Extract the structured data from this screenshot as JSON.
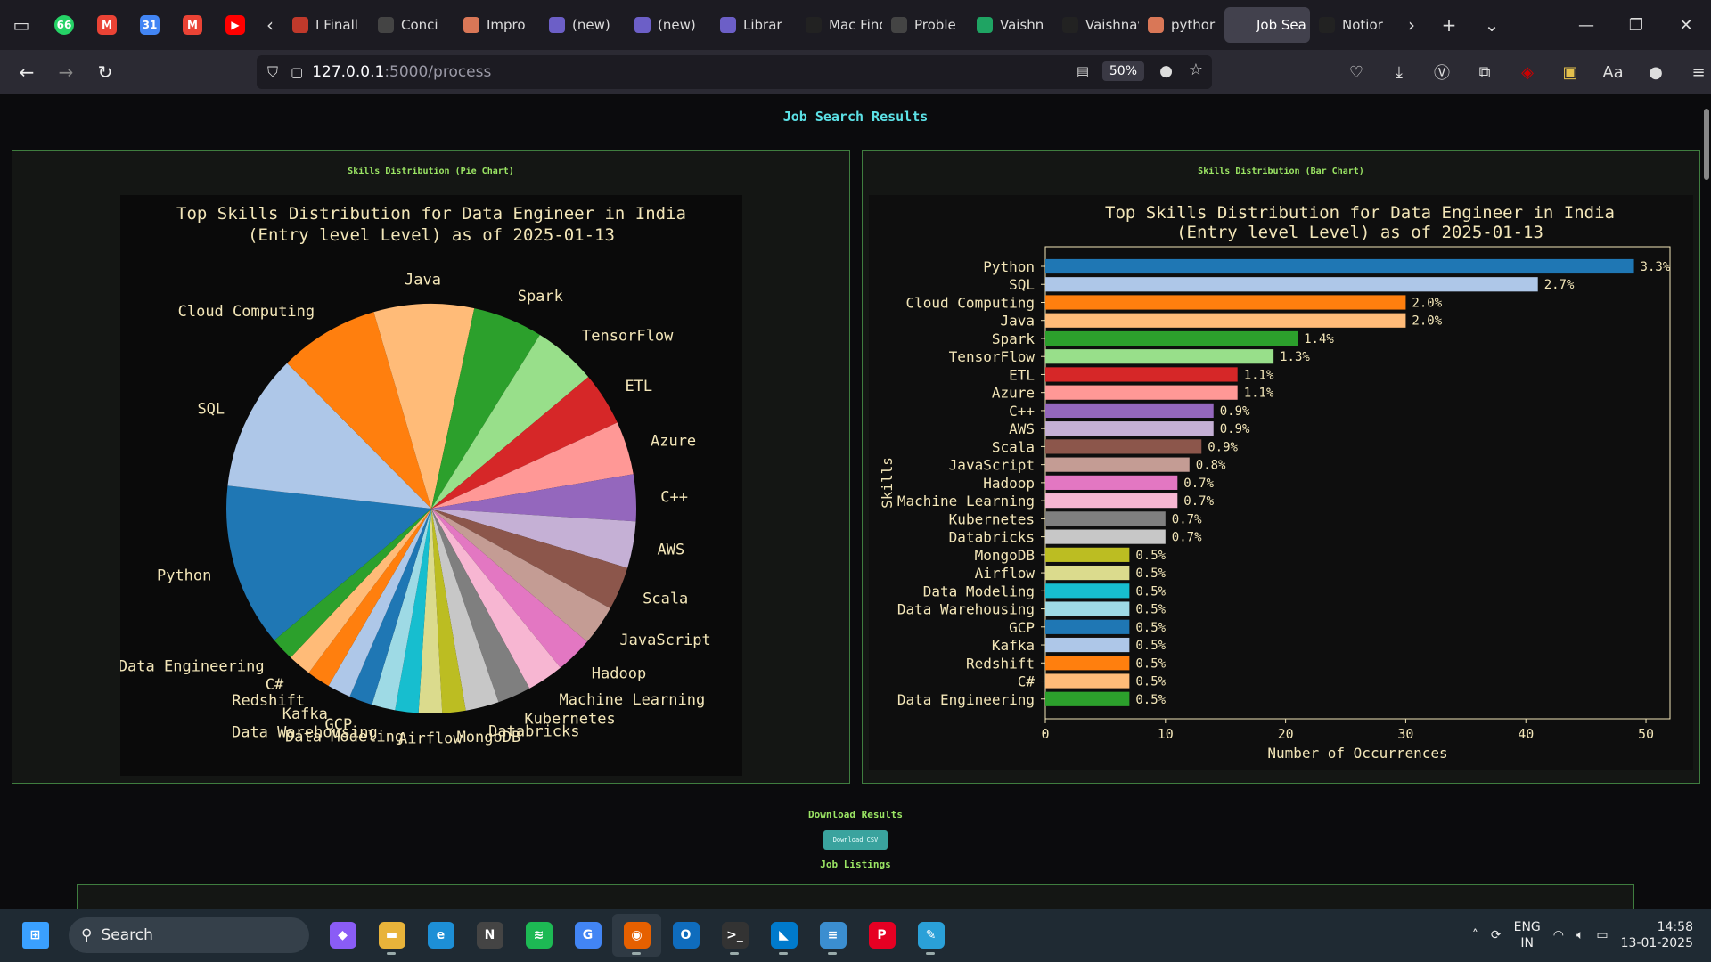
{
  "browser": {
    "tabs": [
      {
        "label": "I Finall",
        "fav": "#c0392b",
        "icon": "pin-icon"
      },
      {
        "label": "Conci",
        "fav": "#444",
        "icon": "openai-icon"
      },
      {
        "label": "Impro",
        "fav": "#d97757",
        "icon": "claude-icon"
      },
      {
        "label": "(new)",
        "fav": "#6c5fc7",
        "icon": "obsidian-icon"
      },
      {
        "label": "(new)",
        "fav": "#6c5fc7",
        "icon": "obsidian-icon"
      },
      {
        "label": "Librar",
        "fav": "#6c5fc7",
        "icon": "obsidian-icon"
      },
      {
        "label": "Mac Finde",
        "fav": "#222",
        "icon": "apple-icon"
      },
      {
        "label": "Proble",
        "fav": "#444",
        "icon": "info-icon"
      },
      {
        "label": "Vaishn",
        "fav": "#1fa463",
        "icon": "drive-icon"
      },
      {
        "label": "Vaishnavi",
        "fav": "#222",
        "icon": "page-icon"
      },
      {
        "label": "pythor",
        "fav": "#d97757",
        "icon": "claude-icon"
      },
      {
        "label": "Job Sea",
        "fav": "#42414d",
        "icon": "page-icon"
      },
      {
        "label": "Notior",
        "fav": "#222",
        "icon": "notion-icon"
      }
    ],
    "url_host": "127.0.0.1",
    "url_path": ":5000/process",
    "zoom": "50%"
  },
  "page": {
    "title": "Job Search Results",
    "pie_panel_title": "Skills Distribution (Pie Chart)",
    "bar_panel_title": "Skills Distribution (Bar Chart)",
    "download_title": "Download Results",
    "download_button": "Download CSV",
    "listings_title": "Job Listings"
  },
  "chart_data": [
    {
      "type": "pie",
      "title": "Top Skills Distribution for Data Engineer in India (Entry level Level) as of 2025-01-13",
      "categories": [
        "Python",
        "SQL",
        "Cloud Computing",
        "Java",
        "Spark",
        "TensorFlow",
        "ETL",
        "Azure",
        "C++",
        "AWS",
        "Scala",
        "JavaScript",
        "Hadoop",
        "Machine Learning",
        "Kubernetes",
        "Databricks",
        "MongoDB",
        "Airflow",
        "Data Modeling",
        "Data Warehousing",
        "GCP",
        "Kafka",
        "Redshift",
        "C#",
        "Data Engineering"
      ],
      "values": [
        49,
        41,
        30,
        30,
        21,
        19,
        16,
        16,
        14,
        14,
        13,
        12,
        11,
        11,
        10,
        10,
        7,
        7,
        7,
        7,
        7,
        7,
        7,
        7,
        7
      ],
      "colors": [
        "#1f77b4",
        "#aec7e8",
        "#ff7f0e",
        "#ffbb78",
        "#2ca02c",
        "#98df8a",
        "#d62728",
        "#ff9896",
        "#9467bd",
        "#c5b0d5",
        "#8c564b",
        "#c49c94",
        "#e377c2",
        "#f7b6d2",
        "#7f7f7f",
        "#c7c7c7",
        "#bcbd22",
        "#dbdb8d",
        "#17becf",
        "#9edae5",
        "#1f77b4",
        "#aec7e8",
        "#ff7f0e",
        "#ffbb78",
        "#2ca02c"
      ]
    },
    {
      "type": "bar",
      "title": "Top Skills Distribution for Data Engineer in India (Entry level Level) as of 2025-01-13",
      "xlabel": "Number of Occurrences",
      "ylabel": "Skills",
      "xlim": [
        0,
        52
      ],
      "xticks": [
        0,
        10,
        20,
        30,
        40,
        50
      ],
      "categories": [
        "Python",
        "SQL",
        "Cloud Computing",
        "Java",
        "Spark",
        "TensorFlow",
        "ETL",
        "Azure",
        "C++",
        "AWS",
        "Scala",
        "JavaScript",
        "Hadoop",
        "Machine Learning",
        "Kubernetes",
        "Databricks",
        "MongoDB",
        "Airflow",
        "Data Modeling",
        "Data Warehousing",
        "GCP",
        "Kafka",
        "Redshift",
        "C#",
        "Data Engineering"
      ],
      "values": [
        49,
        41,
        30,
        30,
        21,
        19,
        16,
        16,
        14,
        14,
        13,
        12,
        11,
        11,
        10,
        10,
        7,
        7,
        7,
        7,
        7,
        7,
        7,
        7,
        7
      ],
      "labels": [
        "3.3%",
        "2.7%",
        "2.0%",
        "2.0%",
        "1.4%",
        "1.3%",
        "1.1%",
        "1.1%",
        "0.9%",
        "0.9%",
        "0.9%",
        "0.8%",
        "0.7%",
        "0.7%",
        "0.7%",
        "0.7%",
        "0.5%",
        "0.5%",
        "0.5%",
        "0.5%",
        "0.5%",
        "0.5%",
        "0.5%",
        "0.5%",
        "0.5%"
      ],
      "colors": [
        "#1f77b4",
        "#aec7e8",
        "#ff7f0e",
        "#ffbb78",
        "#2ca02c",
        "#98df8a",
        "#d62728",
        "#ff9896",
        "#9467bd",
        "#c5b0d5",
        "#8c564b",
        "#c49c94",
        "#e377c2",
        "#f7b6d2",
        "#7f7f7f",
        "#c7c7c7",
        "#bcbd22",
        "#dbdb8d",
        "#17becf",
        "#9edae5",
        "#1f77b4",
        "#aec7e8",
        "#ff7f0e",
        "#ffbb78",
        "#2ca02c"
      ]
    }
  ],
  "taskbar": {
    "search_label": "Search",
    "apps": [
      {
        "name": "copilot-icon",
        "color": "#8a5cf6",
        "glyph": "◆"
      },
      {
        "name": "file-explorer-icon",
        "color": "#e8b33a",
        "glyph": "▬"
      },
      {
        "name": "edge-icon",
        "color": "#1d8fd6",
        "glyph": "e"
      },
      {
        "name": "notion-icon",
        "color": "#444",
        "glyph": "N"
      },
      {
        "name": "spotify-icon",
        "color": "#1db954",
        "glyph": "≋"
      },
      {
        "name": "chrome-icon",
        "color": "#4285f4",
        "glyph": "G"
      },
      {
        "name": "firefox-icon",
        "color": "#e66000",
        "glyph": "◉"
      },
      {
        "name": "outlook-icon",
        "color": "#0f6cbd",
        "glyph": "O"
      },
      {
        "name": "terminal-icon",
        "color": "#333",
        "glyph": ">_"
      },
      {
        "name": "vscode-icon",
        "color": "#007acc",
        "glyph": "◣"
      },
      {
        "name": "notepad-icon",
        "color": "#3b8ed0",
        "glyph": "≡"
      },
      {
        "name": "pinterest-icon",
        "color": "#e60023",
        "glyph": "P"
      },
      {
        "name": "paint-icon",
        "color": "#2aa0d8",
        "glyph": "✎"
      }
    ],
    "lang": "ENG",
    "region": "IN",
    "time": "14:58",
    "date": "13-01-2025"
  }
}
